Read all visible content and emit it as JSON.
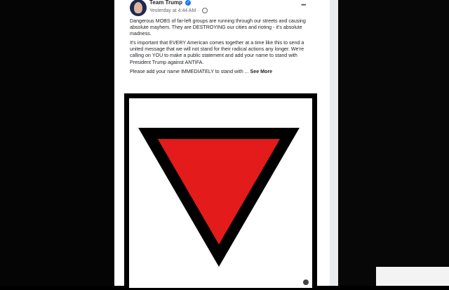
{
  "post": {
    "page_name": "Team Trump",
    "verified_mark": "✓",
    "timestamp": "Yesterday at 4:44 AM",
    "separator": "·",
    "more_label": "•••",
    "paragraphs": [
      "Dangerous MOBS of far-left groups are running through our streets and causing absolute mayhem. They are DESTROYING our cities and rioting - it's absolute madness.",
      "It's important that EVERY American comes together at a time like this to send a united message that we will not stand for their radical actions any longer. We're calling on YOU to make a public statement and add your name to stand with President Trump against ANTIFA."
    ],
    "cta": "Please add your name IMMEDIATELY to stand with ...",
    "see_more": "See More"
  },
  "image": {
    "triangle_fill": "#e31b1b",
    "triangle_stroke": "#000000",
    "frame_color": "#000000"
  }
}
